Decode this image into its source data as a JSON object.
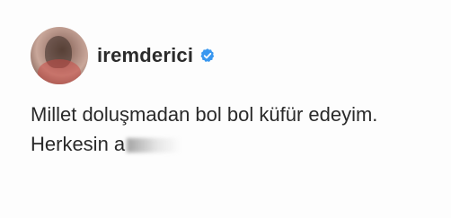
{
  "post": {
    "author": {
      "username": "iremderici",
      "verified": true,
      "verified_color": "#3897f0",
      "avatar_icon": "profile-photo"
    },
    "text_lines": [
      "Millet doluşmadan bol bol küfür edeyim.",
      "Herkesin a"
    ]
  }
}
